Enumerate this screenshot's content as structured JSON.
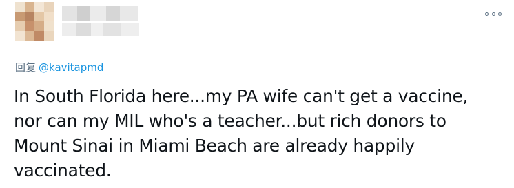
{
  "reply": {
    "prefix": "回复",
    "handle": "@kavitapmd"
  },
  "tweet": {
    "text": "In South Florida here...my PA wife can't get a vaccine,\nnor can my MIL who's a teacher...but rich donors to\nMount Sinai in Miami Beach are already happily\nvaccinated."
  },
  "icons": {
    "more": "more-horizontal-icon"
  },
  "colors": {
    "link": "#1b95e0",
    "secondary_text": "#5b7083",
    "primary_text": "#0f1419"
  }
}
